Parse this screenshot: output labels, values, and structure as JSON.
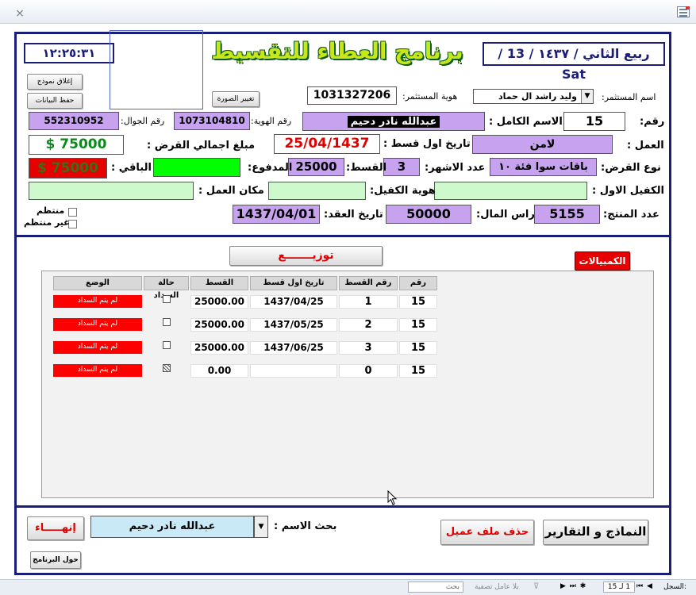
{
  "window": {
    "close_glyph": "⨯"
  },
  "header": {
    "clock": "١٢:٢٥:٣١",
    "app_title": "برنامج العطاء للتقسيط",
    "date": "ربيع الثاني / ١٤٣٧ / 13 / Sat"
  },
  "buttons": {
    "close_form": "إغلاق نموذج",
    "save_data": "حفظ البيانات",
    "change_photo": "تغيير الصورة",
    "distribute": "توزيـــــــع",
    "bills": "الكمبيالات",
    "reports": "النماذج و التقارير",
    "delete_client": "حذف ملف عميل",
    "exit": "إنهـــــاء",
    "about": "حول البرنامج"
  },
  "form": {
    "investor_label": "اسم المستثمر:",
    "investor_value": "وليد راشد ال حماد",
    "investor_id_label": "هوية المستثمر:",
    "investor_id_value": "1031327206",
    "number_label": "رقم:",
    "number_value": "15",
    "fullname_label": "الاسم الكامل :",
    "fullname_value": "عبدالله نادر دحيم",
    "id_label": "رقم الهوية:",
    "id_value": "1073104810",
    "mobile_label": "رقم الجوال:",
    "mobile_value": "552310952",
    "work_label": "العمل :",
    "work_value": "لامن",
    "first_installment_label": "تاريخ اول قسط :",
    "first_installment_value": "25/04/1437",
    "total_label": "مبلغ اجمالي القرض :",
    "total_value": "$ 75000",
    "loan_type_label": "نوع القرض:",
    "loan_type_value": "باقات سوا فئة ١٠",
    "months_label": "عدد الاشهر:",
    "months_value": "3",
    "installment_label": "القسط:",
    "installment_value": "25000",
    "paid_label": "المدفوع:",
    "paid_value": "",
    "remaining_label": "الباقي :",
    "remaining_value": "$ 75000",
    "guarantor_label": "الكفيل الاول :",
    "guarantor_value": "",
    "guarantor_id_label": "هوية الكفيل:",
    "guarantor_id_value": "",
    "workplace_label": "مكان العمل :",
    "workplace_value": "",
    "product_count_label": "عدد المنتج:",
    "product_count_value": "5155",
    "capital_label": "راس المال:",
    "capital_value": "50000",
    "contract_date_label": "تاريخ العقد:",
    "contract_date_value": "1437/04/01",
    "regular_label": "منتظم",
    "irregular_label": "غير منتظم"
  },
  "table": {
    "headers": [
      "رقم",
      "رقم القسط",
      "تاريخ اول قسط",
      "القسط",
      "حالة السداد",
      "الوضع"
    ],
    "rows": [
      {
        "num": "15",
        "inst": "1",
        "date": "1437/04/25",
        "amount": "25000.00",
        "paid": false,
        "status": "لم يتم السداد"
      },
      {
        "num": "15",
        "inst": "2",
        "date": "1437/05/25",
        "amount": "25000.00",
        "paid": false,
        "status": "لم يتم السداد"
      },
      {
        "num": "15",
        "inst": "3",
        "date": "1437/06/25",
        "amount": "25000.00",
        "paid": false,
        "status": "لم يتم السداد"
      },
      {
        "num": "15",
        "inst": "0",
        "date": "",
        "amount": "0.00",
        "paid": true,
        "status": "لم يتم السداد"
      }
    ]
  },
  "search": {
    "label": "بحث الاسم :",
    "value": "عبدالله نادر دحيم"
  },
  "statusbar": {
    "record_label": "السجل:",
    "record_value": "1 لـ 15",
    "no_filter": "بلا عامل تصفية",
    "search": "بحث"
  },
  "colors": {
    "frame": "#1a1e78",
    "purple": "#c7a3ef",
    "light_green": "#cdf9cd",
    "red": "#ff0000",
    "green": "#00ff00"
  }
}
